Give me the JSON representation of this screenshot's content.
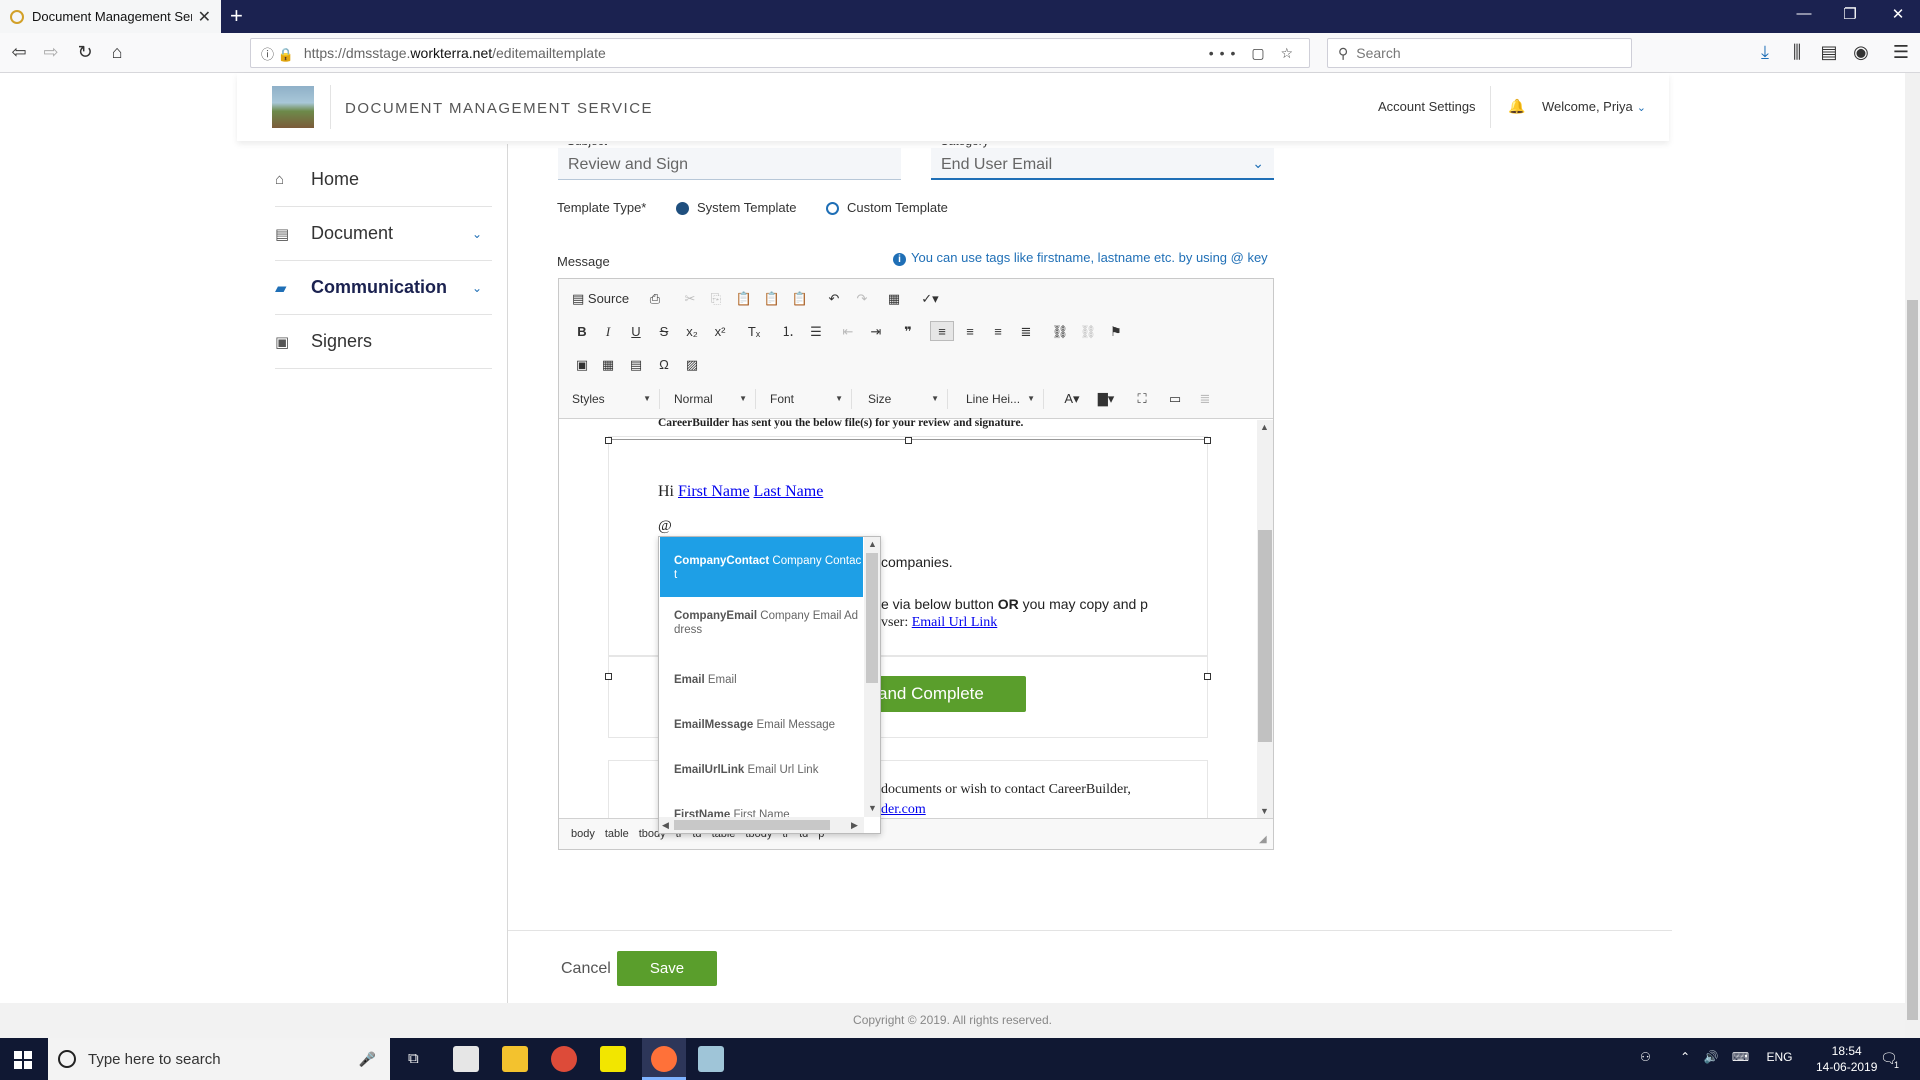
{
  "browser": {
    "tab_title": "Document Management Servic",
    "url_prefix": "https://dmsstage.",
    "url_domain": "workterra.net",
    "url_path": "/editemailtemplate",
    "search_placeholder": "Search"
  },
  "header": {
    "brand": "DOCUMENT MANAGEMENT SERVICE",
    "account_settings": "Account Settings",
    "welcome": "Welcome, Priya"
  },
  "sidebar": {
    "items": [
      {
        "label": "Home"
      },
      {
        "label": "Document"
      },
      {
        "label": "Communication"
      },
      {
        "label": "Signers"
      }
    ]
  },
  "form": {
    "subject_label": "Subject",
    "subject_value": "Review and Sign",
    "category_label": "Category",
    "category_value": "End User Email",
    "template_type_label": "Template Type*",
    "system_template": "System Template",
    "custom_template": "Custom Template",
    "message_label": "Message",
    "hint": "You can use tags like firstname, lastname etc. by using @ key"
  },
  "toolbar": {
    "source": "Source",
    "styles": "Styles",
    "format": "Normal",
    "font": "Font",
    "size": "Size",
    "line_height": "Line Hei..."
  },
  "content": {
    "top_line": "CareerBuilder has sent you the below file(s) for your review and signature.",
    "hi": "Hi",
    "first_name": "First Name",
    "last_name": "Last Name",
    "at": "@",
    "companies": "companies.",
    "line2a": "e via below button ",
    "line2b": "OR",
    "line2c": " you may copy and p",
    "line3": "vser: ",
    "email_url_link": "Email Url Link",
    "button": "and Complete",
    "line4": "documents or wish to contact CareerBuilder,",
    "line5": "der.com"
  },
  "autocomplete": {
    "items": [
      {
        "key": "CompanyContact",
        "desc": "Company Contact"
      },
      {
        "key": "CompanyEmail",
        "desc": "Company Email Address"
      },
      {
        "key": "Email",
        "desc": "Email"
      },
      {
        "key": "EmailMessage",
        "desc": "Email Message"
      },
      {
        "key": "EmailUrlLink",
        "desc": "Email Url Link"
      },
      {
        "key": "FirstName",
        "desc": "First Name"
      }
    ]
  },
  "pathbar": [
    "body",
    "table",
    "tbody",
    "tr",
    "td",
    "table",
    "tbody",
    "tr",
    "td",
    "p"
  ],
  "actions": {
    "cancel": "Cancel",
    "save": "Save"
  },
  "footer": {
    "copyright": "Copyright © 2019. All rights reserved."
  },
  "taskbar": {
    "search_placeholder": "Type here to search",
    "lang": "ENG",
    "time": "18:54",
    "date": "14-06-2019",
    "notif_count": "1"
  },
  "colors": {
    "accent": "#1f6fb6",
    "brand_dark": "#1b2250",
    "save_green": "#5a9e2c",
    "selection_blue": "#1e9fe6"
  }
}
